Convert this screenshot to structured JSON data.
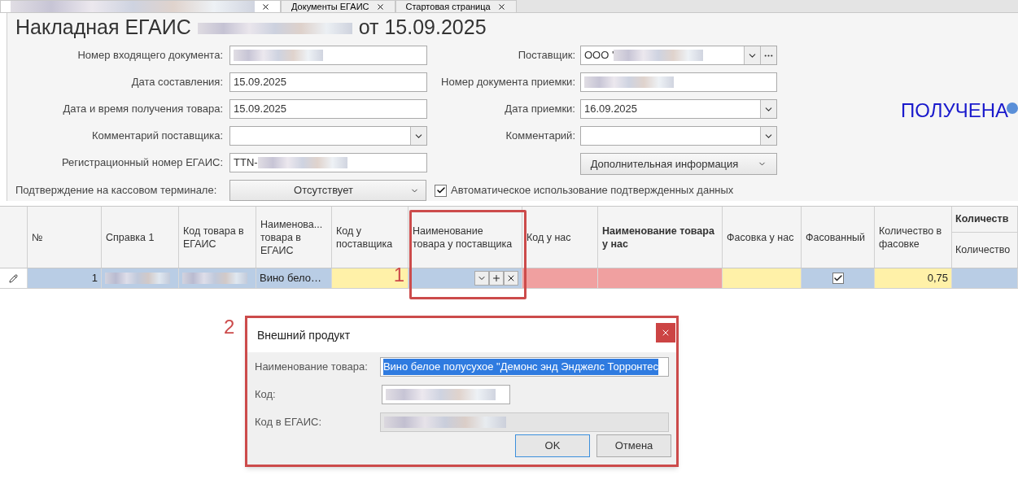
{
  "tabs": [
    {
      "kind": "redacted",
      "selected": true
    },
    {
      "kind": "text",
      "label": "Документы ЕГАИС",
      "selected": false
    },
    {
      "kind": "text",
      "label": "Стартовая страница",
      "selected": false
    }
  ],
  "title": {
    "prefix": "Накладная ЕГАИС",
    "suffix": "от 15.09.2025"
  },
  "left_fields": [
    {
      "label": "Номер входящего документа:",
      "kind": "text",
      "redacted": true
    },
    {
      "label": "Дата составления:",
      "kind": "text",
      "value": "15.09.2025"
    },
    {
      "label": "Дата и время получения товара:",
      "kind": "text",
      "value": "15.09.2025"
    },
    {
      "label": "Комментарий поставщика:",
      "kind": "dropdown"
    },
    {
      "label": "Регистрационный номер ЕГАИС:",
      "kind": "text",
      "value": "TTN-",
      "redacted": true
    }
  ],
  "right_fields": [
    {
      "label": "Поставщик:",
      "kind": "lookup",
      "value": "ООО '",
      "redacted": true
    },
    {
      "label": "Номер документа приемки:",
      "kind": "text",
      "redacted": true
    },
    {
      "label": "Дата приемки:",
      "kind": "dropdown",
      "value": "16.09.2025"
    },
    {
      "label": "Комментарий:",
      "kind": "dropdown"
    }
  ],
  "extra_info_button": "Дополнительная информация",
  "status": "ПОЛУЧЕНА",
  "terminal_confirmation": {
    "label": "Подтверждение на кассовом терминале:",
    "value": "Отсутствует"
  },
  "auto_use": {
    "label": "Автоматическое использование подтвержденных данных",
    "checked": true
  },
  "table": {
    "columns": [
      {},
      {
        "label": "№"
      },
      {
        "label": "Справка 1"
      },
      {
        "label": "Код товара в ЕГАИС"
      },
      {
        "label": "Наименова... товара в ЕГАИС"
      },
      {
        "label": "Код у поставщика"
      },
      {
        "label": "Наименование товара у поставщика"
      },
      {
        "label": "Код у нас"
      },
      {
        "label": "Наименование товара у нас",
        "emphasis": true
      },
      {
        "label": "Фасовка у нас"
      },
      {
        "label": "Фасованный"
      },
      {
        "label": "Количество в фасовке"
      },
      {
        "label": "Количество",
        "group": "Количеств"
      }
    ],
    "rows": [
      {
        "cells": [
          {
            "kind": "edit"
          },
          {
            "kind": "number",
            "text": "1",
            "color": "#b9cde5"
          },
          {
            "kind": "redacted",
            "color": "#b9cde5"
          },
          {
            "kind": "redacted",
            "color": "#b9cde5"
          },
          {
            "kind": "text",
            "text": "Вино бело…",
            "color": "#b9cde5"
          },
          {
            "kind": "empty",
            "color": "#fff1a8"
          },
          {
            "kind": "editor",
            "color": "#b9cde5"
          },
          {
            "kind": "empty",
            "color": "#f0a0a0"
          },
          {
            "kind": "empty",
            "color": "#f0a0a0"
          },
          {
            "kind": "empty",
            "color": "#fff1a8"
          },
          {
            "kind": "checkbox",
            "checked": true,
            "color": "#b9cde5"
          },
          {
            "kind": "number",
            "text": "0,75",
            "color": "#fff1a8"
          },
          {
            "kind": "empty",
            "color": "#b9cde5"
          }
        ]
      }
    ]
  },
  "dialog": {
    "title": "Внешний продукт",
    "fields": [
      {
        "label": "Наименование товара:",
        "kind": "selected_text",
        "value": "Вино белое полусухое \"Демонс энд Энджелс Торронтес"
      },
      {
        "label": "Код:",
        "kind": "redacted",
        "disabled": false
      },
      {
        "label": "Код в ЕГАИС:",
        "kind": "redacted",
        "disabled": true
      }
    ],
    "buttons": [
      {
        "label": "OK",
        "default": true
      },
      {
        "label": "Отмена",
        "default": false
      }
    ]
  },
  "callouts": [
    {
      "number": "1"
    },
    {
      "number": "2"
    }
  ]
}
